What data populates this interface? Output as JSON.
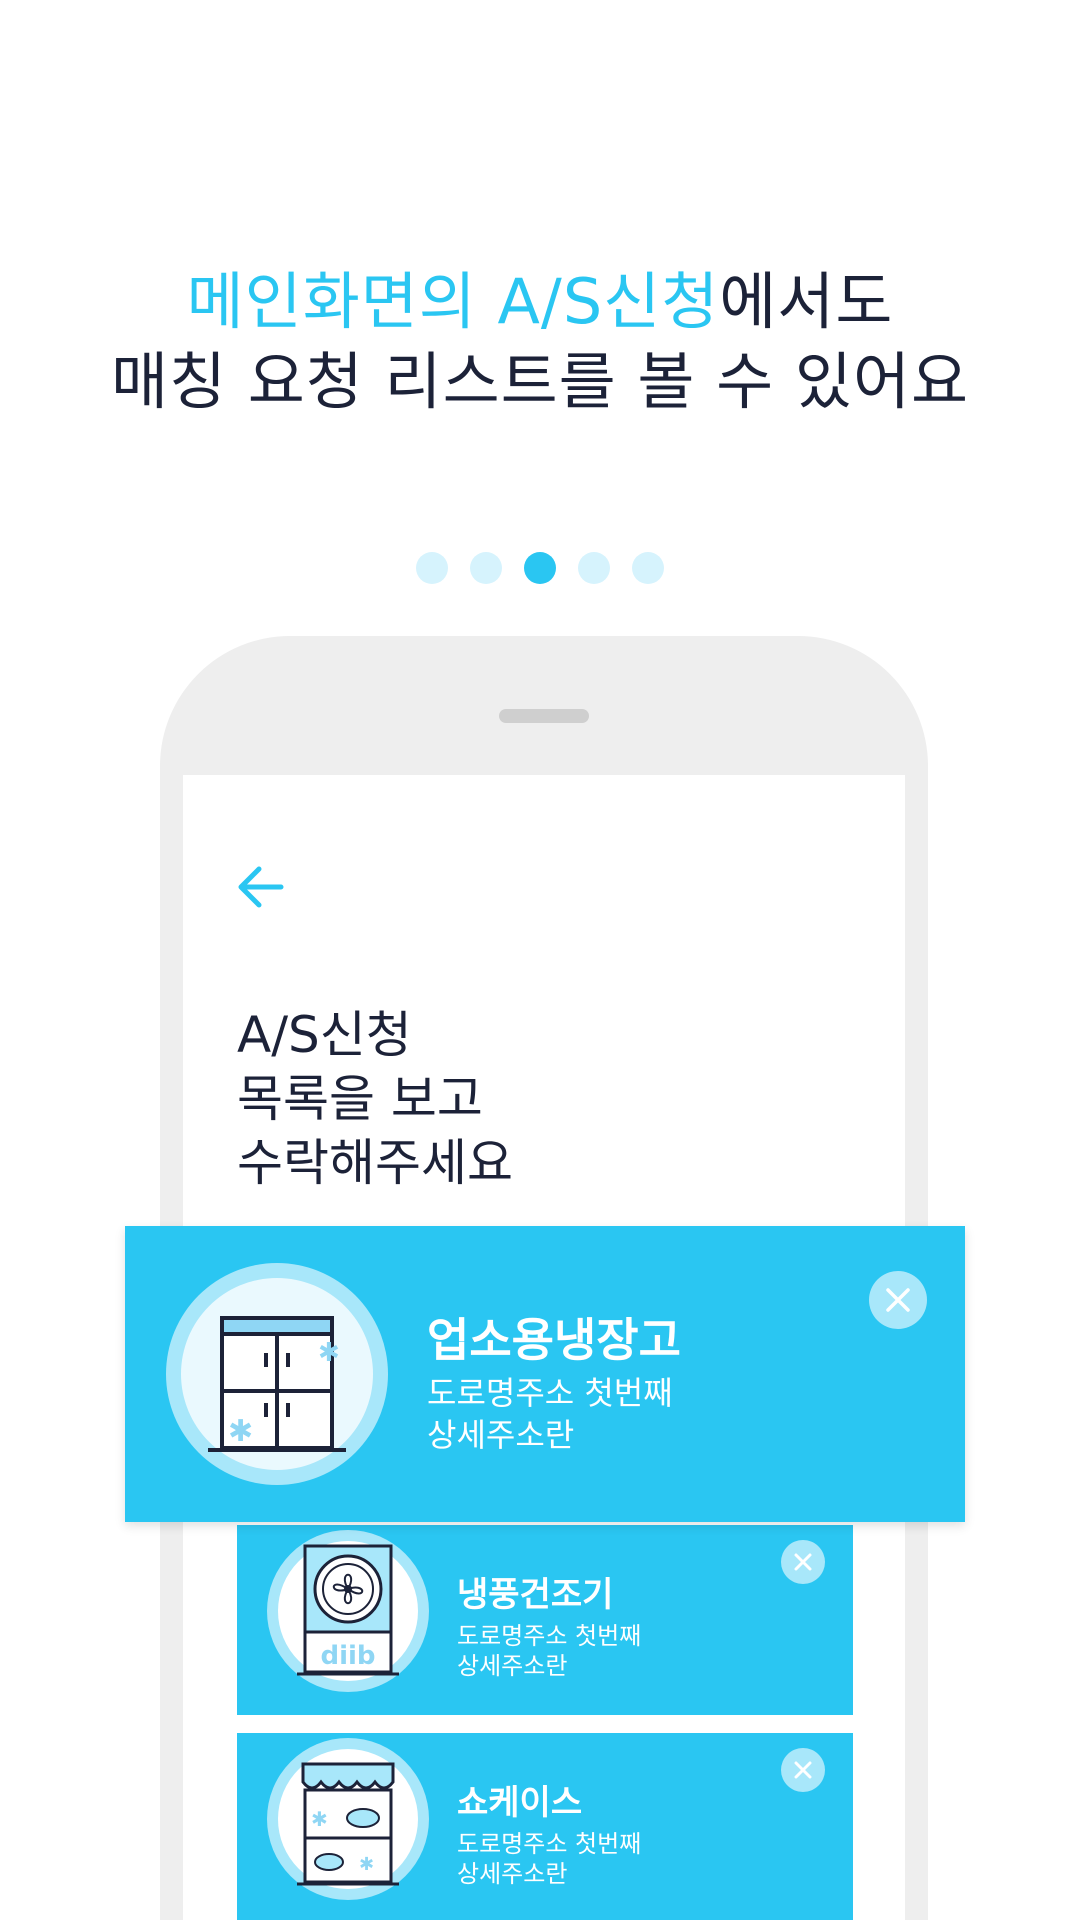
{
  "headline": {
    "line1_accent": "메인화면의 A/S신청",
    "line1_rest": "에서도",
    "line2": "매칭 요청 리스트를 볼 수 있어요"
  },
  "pager": {
    "total": 5,
    "active_index": 2
  },
  "screen": {
    "back_icon": "arrow-left-icon",
    "title": "A/S신청\n목록을 보고\n수락해주세요"
  },
  "cards": [
    {
      "name": "업소용냉장고",
      "address": "도로명주소 첫번째\n상세주소란",
      "icon": "refrigerator-icon"
    },
    {
      "name": "냉풍건조기",
      "address": "도로명주소 첫번째\n상세주소란",
      "icon": "dryer-icon"
    },
    {
      "name": "쇼케이스",
      "address": "도로명주소 첫번째\n상세주소란",
      "icon": "showcase-icon"
    }
  ],
  "colors": {
    "accent": "#2ac6f2",
    "text": "#1c2238",
    "light_accent": "#a8e7fa",
    "phone_frame": "#eeeeee"
  }
}
